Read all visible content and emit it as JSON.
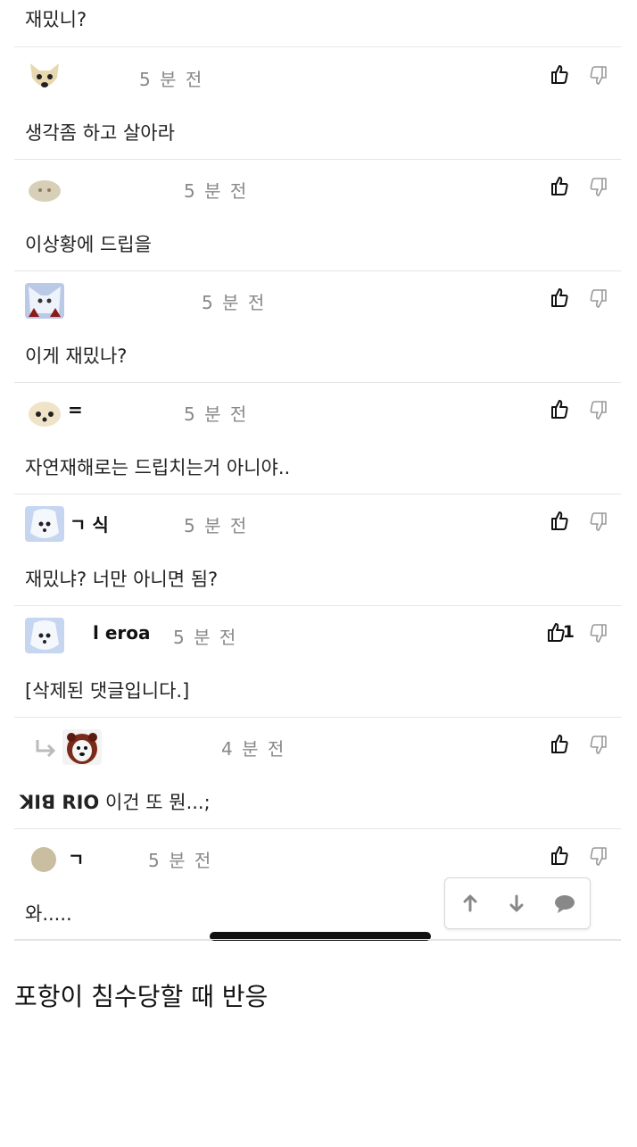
{
  "top_comment_text": "재밌니?",
  "comments": [
    {
      "username": "",
      "time": "5 분 전",
      "text": "생각좀 하고 살아라",
      "likes": ""
    },
    {
      "username": "",
      "time": "5 분 전",
      "text": "이상황에 드립을",
      "likes": ""
    },
    {
      "username": "",
      "time": "5 분 전",
      "text": "이게 재밌나?",
      "likes": ""
    },
    {
      "username": "=",
      "time": "5 분 전",
      "text": "자연재해로는 드립치는거 아니야..",
      "likes": ""
    },
    {
      "username": "ㄱ       식",
      "time": "5 분 전",
      "text": "재밌냐? 너만 아니면 됨?",
      "likes": ""
    },
    {
      "username": "l     eroa",
      "time": "5 분 전",
      "text": "[삭제된 댓글입니다.]",
      "likes": "1"
    },
    {
      "username": "",
      "time": "4 분 전",
      "text": "이건 또 뭔...;",
      "mention": "ꓘꓲꓭ ꓣꓲꓳ",
      "likes": ""
    },
    {
      "username": "ㄱ",
      "time": "5 분 전",
      "text": "와.....",
      "likes": ""
    }
  ],
  "icons": {
    "like": "thumbs-up-icon",
    "dislike": "thumbs-down-icon",
    "reply": "reply-arrow-icon",
    "nav_up": "arrow-up-icon",
    "nav_down": "arrow-down-icon",
    "nav_comment": "speech-bubble-icon"
  },
  "caption": "포항이 침수당할 때 반응"
}
